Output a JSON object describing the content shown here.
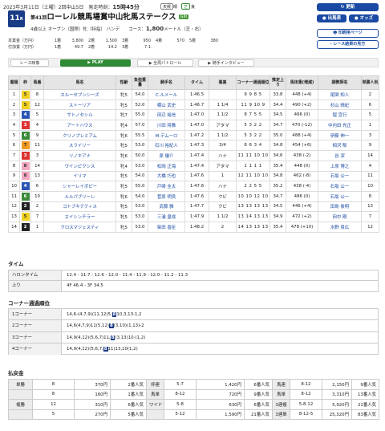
{
  "header": {
    "date": "2023年3月11日（土曜）2回中山5日",
    "start_label": "発走時刻：",
    "start_time": "15時45分",
    "weather": "天候",
    "weather_val": "晴",
    "track": "芝",
    "track_cond": "良",
    "update_btn": "更新",
    "entry_btn": "出馬表",
    "odds_btn": "オッズ",
    "print_btn": "印刷用ページ",
    "list_btn": "レース結果の見方"
  },
  "race": {
    "number": "11",
    "number_suffix": "R",
    "edition": "第41回",
    "name": "ローレル競馬場賞中山牝馬ステークス",
    "grade": "GIII",
    "conditions": "4歳以上 オープン（国際）牝（特指） ハンデ",
    "course_label": "コース：",
    "distance": "1,800",
    "distance_unit": "メートル（芝・右）"
  },
  "prize": {
    "row1_label": "本賞金（万円）",
    "row1": [
      "1着",
      "3,800",
      "2着",
      "1,500",
      "3着",
      "950",
      "4着",
      "570",
      "5着",
      "380"
    ],
    "row2_label": "付加賞（万円）",
    "row2": [
      "1着",
      "49.7",
      "2着",
      "14.2",
      "3着",
      "7.1"
    ]
  },
  "tabs": {
    "video": "レース映像",
    "play": "PLAY",
    "patrol": "全周パトロール",
    "interview": "騎手インタビュー"
  },
  "table": {
    "headers": [
      "着順",
      "枠",
      "馬番",
      "馬名",
      "性齢",
      "負担重量",
      "騎手名",
      "タイム",
      "着差",
      "コーナー通過順位",
      "推定上り",
      "馬体重(増減)",
      "調教師名",
      "単勝人気"
    ],
    "rows": [
      [
        "1",
        "5",
        "8",
        "スルーセブンシーズ",
        "牝5",
        "54.0",
        "C.ルメール",
        "1:46.5",
        "",
        "9 9 8 5",
        "33.8",
        "448 (+4)",
        "尾関 知人",
        "2"
      ],
      [
        "2",
        "5",
        "12",
        "ストーリア",
        "牝5",
        "52.0",
        "横山 武史",
        "1:46.7",
        "1 1/4",
        "11 9 10 9",
        "34.4",
        "490 (+2)",
        "杉山 晴紀",
        "6"
      ],
      [
        "3",
        "4",
        "5",
        "サトノセシル",
        "牝7",
        "55.0",
        "田辺 裕信",
        "1:47.0",
        "1 1/2",
        "8 7 5 5",
        "34.5",
        "466 (0)",
        "堀 宣行",
        "5"
      ],
      [
        "4",
        "3",
        "4",
        "アートハウス",
        "牝4",
        "57.0",
        "川田 将雅",
        "1:47.0",
        "アタマ",
        "5 3 2 2",
        "34.7",
        "470 (-12)",
        "中内田 充正",
        "1"
      ],
      [
        "5",
        "6",
        "9",
        "クリノプレミアム",
        "牝6",
        "55.5",
        "M.デムーロ",
        "1:47.2",
        "1 1/2",
        "5 3 2 2",
        "35.0",
        "488 (+4)",
        "伊藤 伸一",
        "3"
      ],
      [
        "6",
        "7",
        "11",
        "スライリー",
        "牝5",
        "53.0",
        "石川 裕紀人",
        "1:47.3",
        "3/4",
        "8 6 3 4",
        "34.8",
        "454 (+6)",
        "相沢 郁",
        "9"
      ],
      [
        "7",
        "3",
        "3",
        "リノキアナ",
        "牝6",
        "50.0",
        "原 優介",
        "1:47.4",
        "ハナ",
        "11 11 10 10",
        "34.6",
        "438 (-2)",
        "谷 潔",
        "14"
      ],
      [
        "8",
        "8",
        "14",
        "ウインピクシス",
        "牝4",
        "53.0",
        "松岡 正海",
        "1:47.4",
        "アタマ",
        "1 1 1 1",
        "35.4",
        "448 (0)",
        "上原 博之",
        "4"
      ],
      [
        "9",
        "8",
        "13",
        "イリマ",
        "牝5",
        "54.0",
        "大橋 巧也",
        "1:47.6",
        "1",
        "12 11 10 10",
        "34.8",
        "462 (-8)",
        "石坂 公一",
        "11"
      ],
      [
        "10",
        "4",
        "6",
        "シャーレイポピー",
        "牝5",
        "55.0",
        "戸崎 圭太",
        "1:47.6",
        "ハナ",
        "2 2 5 5",
        "35.2",
        "438 (-4)",
        "石坂 公一",
        "10"
      ],
      [
        "11",
        "6",
        "10",
        "ルルパブリーレ",
        "牝6",
        "54.0",
        "菅原 明良",
        "1:47.6",
        "クビ",
        "10 10 12 10",
        "34.7",
        "486 (0)",
        "石坂 公一",
        "8"
      ],
      [
        "12",
        "2",
        "2",
        "コトブキテティス",
        "牝5",
        "53.0",
        "武藤 雅",
        "1:47.7",
        "クビ",
        "13 13 13 13",
        "34.5",
        "446 (+4)",
        "田島 俊明",
        "13"
      ],
      [
        "13",
        "5",
        "7",
        "エイシンチラー",
        "牝5",
        "53.0",
        "三浦 皇成",
        "1:47.9",
        "1 1/2",
        "13 14 13 13",
        "34.9",
        "472 (+2)",
        "田中 剛",
        "7"
      ],
      [
        "14",
        "2",
        "1",
        "クロスマジェスティ",
        "牝5",
        "53.0",
        "柴田 善臣",
        "1:48.2",
        "2",
        "14 13 13 13",
        "35.4",
        "478 (+10)",
        "水野 貴広",
        "12"
      ]
    ]
  },
  "time": {
    "title": "タイム",
    "lap_label": "ハロンタイム",
    "lap": "12.4 - 11.7 - 12.6 - 12.0 - 11.4 - 11.9 - 12.0 - 11.2 - 11.3",
    "agari_label": "上り",
    "agari": "4F 46.4 - 3F 34.5"
  },
  "corners": {
    "title": "コーナー通過順位",
    "items": [
      {
        "label": "1コーナー",
        "pre": "14,6-(4,7,9)(11,12)5,",
        "mark": "8",
        "post": "10,3,13-1,2"
      },
      {
        "label": "2コーナー",
        "pre": "14,6(4,7,9)11(5,12)",
        "mark": "8",
        "post": "(3,10)(1,13)-2"
      },
      {
        "label": "3コーナー",
        "pre": "14,9(4,12)(5,6,7)11,",
        "mark": "8",
        "post": "(3,13)10-(1,2)"
      },
      {
        "label": "4コーナー",
        "pre": "14,9(4,12)(5,6,7,",
        "mark": "8",
        "post": "11)13,10(1,2)"
      }
    ]
  },
  "payout": {
    "title": "払戻金",
    "rows": [
      [
        "単勝",
        "8",
        "370円",
        "2番人気",
        "枠連",
        "5-7",
        "1,420円",
        "6番人気",
        "馬連",
        "8-12",
        "2,150円",
        "9番人気"
      ],
      [
        "",
        "8",
        "160円",
        "1番人気",
        "馬単",
        "8-12",
        "720円",
        "9番人気",
        "馬単",
        "8-12",
        "3,310円",
        "13番人気"
      ],
      [
        "複勝",
        "12",
        "310円",
        "6番人気",
        "ワイド",
        "5-8",
        "630円",
        "6番人気",
        "3連複",
        "5-8-12",
        "5,920円",
        "21番人気"
      ],
      [
        "",
        "5",
        "270円",
        "5番人気",
        "",
        "5-12",
        "1,590円",
        "21番人気",
        "3連単",
        "8-12-5",
        "25,320円",
        "83番人気"
      ]
    ]
  },
  "colors": {
    "navy": "#1a3c87",
    "blue": "#1a4aa3",
    "green": "#2f8a35"
  }
}
